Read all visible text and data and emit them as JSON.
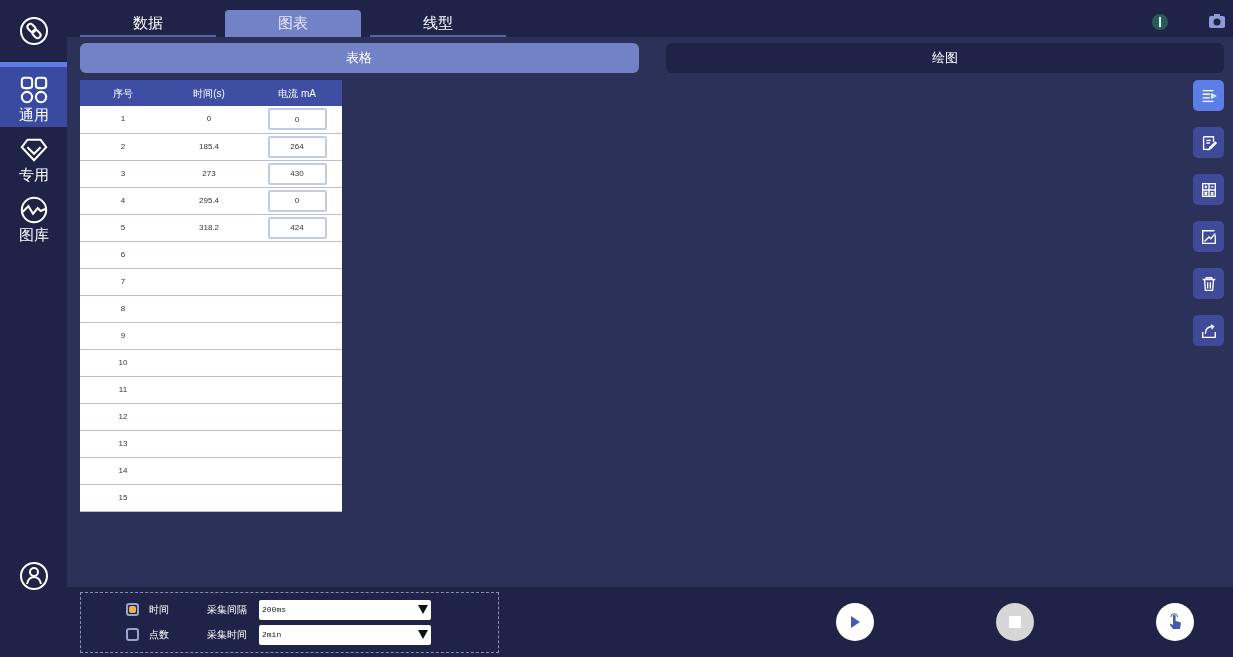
{
  "sidebar": {
    "items": [
      {
        "kind": "grid",
        "label": "通用",
        "selected": true
      },
      {
        "kind": "diamond",
        "label": "专用",
        "selected": false
      },
      {
        "kind": "wave",
        "label": "图库",
        "selected": false
      }
    ]
  },
  "tabs": [
    {
      "label": "数据",
      "selected": false
    },
    {
      "label": "图表",
      "selected": true
    },
    {
      "label": "线型",
      "selected": false
    }
  ],
  "subtabs": [
    {
      "label": "表格",
      "selected": true
    },
    {
      "label": "绘图",
      "selected": false
    }
  ],
  "table": {
    "columns": [
      "序号",
      "时间(s)",
      "电流 mA"
    ],
    "rows": [
      {
        "index": "1",
        "time": "0",
        "current": "0"
      },
      {
        "index": "2",
        "time": "185.4",
        "current": "264"
      },
      {
        "index": "3",
        "time": "273",
        "current": "430"
      },
      {
        "index": "4",
        "time": "295.4",
        "current": "0"
      },
      {
        "index": "5",
        "time": "318.2",
        "current": "424"
      },
      {
        "index": "6"
      },
      {
        "index": "7"
      },
      {
        "index": "8"
      },
      {
        "index": "9"
      },
      {
        "index": "10"
      },
      {
        "index": "11"
      },
      {
        "index": "12"
      },
      {
        "index": "13"
      },
      {
        "index": "14"
      },
      {
        "index": "15"
      }
    ]
  },
  "toolbar": [
    {
      "kind": "list",
      "selected": true
    },
    {
      "kind": "edit",
      "selected": false
    },
    {
      "kind": "calc",
      "selected": false
    },
    {
      "kind": "chart",
      "selected": false
    },
    {
      "kind": "trash",
      "selected": false
    },
    {
      "kind": "export",
      "selected": false
    }
  ],
  "acquisition": {
    "modes": [
      {
        "label": "时间",
        "selected": true
      },
      {
        "label": "点数",
        "selected": false
      }
    ],
    "settings": [
      {
        "label": "采集间隔",
        "value": "200ms"
      },
      {
        "label": "采集时间",
        "value": "2min"
      }
    ]
  },
  "controls": [
    {
      "kind": "play",
      "disabled": false
    },
    {
      "kind": "stop",
      "disabled": true
    },
    {
      "kind": "touch",
      "disabled": false
    }
  ]
}
